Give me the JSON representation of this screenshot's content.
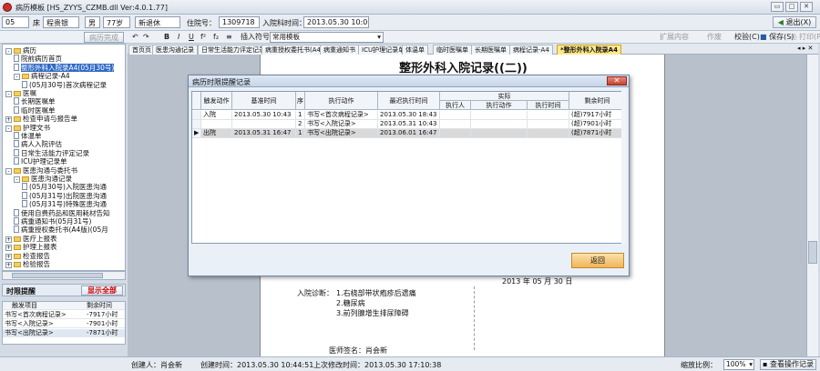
{
  "window": {
    "title": "病历模板 [HS_ZYYS_CZMB.dll Ver:4.0.1.77]",
    "min_label": "▭",
    "max_label": "□",
    "close_label": "✕"
  },
  "patient": {
    "bed": "05",
    "bed_label": "床",
    "name": "程贵银",
    "gender": "男",
    "age": "77岁",
    "insurance": "新退休",
    "inpatient_no_label": "住院号：",
    "inpatient_no": "1309718",
    "admit_time_label": "入院科时间：",
    "admit_time": "2013.05.30 10:00",
    "exit_label": "退出(X)"
  },
  "toolbar": {
    "complete": "病历完成",
    "bold": "B",
    "italic": "I",
    "underline": "U",
    "superscript": "f²",
    "subscript": "f₂",
    "insert_symbol_label": "插入符号",
    "insert_symbol_value": "常用模板",
    "expand": "扩展内容",
    "invalid": "作废",
    "validate": "校验(C)",
    "save": "保存(S)",
    "print": "打印(P)"
  },
  "tree": {
    "items": [
      {
        "text": "病历",
        "level": 0,
        "type": "folder",
        "exp": "-"
      },
      {
        "text": "院前病历首页",
        "level": 1,
        "type": "doc"
      },
      {
        "text": "整形外科入院录A4(05月30号)",
        "level": 1,
        "type": "doc",
        "selected": true
      },
      {
        "text": "病程记录-A4",
        "level": 1,
        "type": "folder",
        "exp": "-"
      },
      {
        "text": "(05月30号)首次病程记录",
        "level": 2,
        "type": "doc"
      },
      {
        "text": "医嘱",
        "level": 0,
        "type": "folder",
        "exp": "-"
      },
      {
        "text": "长期医嘱单",
        "level": 1,
        "type": "doc"
      },
      {
        "text": "临时医嘱单",
        "level": 1,
        "type": "doc"
      },
      {
        "text": "检查申请与报告单",
        "level": 0,
        "type": "folder",
        "exp": "+"
      },
      {
        "text": "护理文书",
        "level": 0,
        "type": "folder",
        "exp": "-"
      },
      {
        "text": "体温单",
        "level": 1,
        "type": "doc"
      },
      {
        "text": "病人入院评估",
        "level": 1,
        "type": "doc"
      },
      {
        "text": "日常生活能力评定记录",
        "level": 1,
        "type": "doc"
      },
      {
        "text": "ICU护理记录单",
        "level": 1,
        "type": "doc"
      },
      {
        "text": "医患沟通与委托书",
        "level": 0,
        "type": "folder",
        "exp": "-"
      },
      {
        "text": "医患沟通记录",
        "level": 1,
        "type": "folder",
        "exp": "-"
      },
      {
        "text": "(05月30号)入院医患沟通",
        "level": 2,
        "type": "doc"
      },
      {
        "text": "(05月31号)出院医患沟通",
        "level": 2,
        "type": "doc"
      },
      {
        "text": "(05月31号)特殊医患沟通",
        "level": 2,
        "type": "doc"
      },
      {
        "text": "使用自费药品和医用耗材告知",
        "level": 1,
        "type": "doc"
      },
      {
        "text": "病重通知书(05月31号)",
        "level": 1,
        "type": "doc"
      },
      {
        "text": "病重授权委托书(A4版)(05月",
        "level": 1,
        "type": "doc"
      },
      {
        "text": "医疗上报表",
        "level": 0,
        "type": "folder",
        "exp": "+"
      },
      {
        "text": "护理上报表",
        "level": 0,
        "type": "folder",
        "exp": "+"
      },
      {
        "text": "检查报告",
        "level": 0,
        "type": "folder",
        "exp": "+"
      },
      {
        "text": "检验报告",
        "level": 0,
        "type": "folder",
        "exp": "+"
      }
    ]
  },
  "reminder": {
    "title": "时限提醒",
    "show_all": "显示全部",
    "headers": [
      "触发项目",
      "剩余时间"
    ],
    "rows": [
      {
        "item": "书写<首次病程记录>",
        "time": "-7917小时"
      },
      {
        "item": "书写<入院记录>",
        "time": "-7901小时"
      },
      {
        "item": "书写<出院记录>",
        "time": "-7871小时"
      }
    ]
  },
  "tabs": [
    "首页页",
    "医患沟通记录",
    "日常生活能力评定记录",
    "病重授权委托书(A4版)",
    "病重通知书",
    "ICU护理记录单",
    "体温单",
    "临时医嘱单",
    "长期医嘱单",
    "病程记录-A4",
    "*整形外科入院录A4"
  ],
  "document": {
    "title": "整形外科入院记录((二))",
    "signed_date": "2013 年 05 月 30 日",
    "diag_label": "入院诊断：",
    "diagnoses": [
      "1.右桡部带状疱疹后遗痛",
      "2.糖尿病",
      "3.前列腺增生排尿障碍"
    ],
    "doctor_label": "医师签名：",
    "doctor": "肖会新"
  },
  "modal": {
    "title": "病历时限提醒记录",
    "headers": {
      "trigger": "触发动作",
      "base_time": "基准时间",
      "seq": "序",
      "action": "执行动作",
      "deadline": "最迟执行时间",
      "actual": "实际",
      "executor": "执行人",
      "exec_action": "执行动作",
      "exec_time": "执行时间",
      "remaining": "剩余时间"
    },
    "rows": [
      {
        "trigger": "入院",
        "base_time": "2013.05.30 10:43",
        "seq": "1",
        "action": "书写<首次病程记录>",
        "deadline": "2013.05.30 18:43",
        "executor": "",
        "exec_action": "",
        "exec_time": "",
        "remaining": "(超)7917小时",
        "selected": false
      },
      {
        "trigger": "",
        "base_time": "",
        "seq": "2",
        "action": "书写<入院记录>",
        "deadline": "2013.05.31 10:43",
        "executor": "",
        "exec_action": "",
        "exec_time": "",
        "remaining": "(超)7901小时",
        "selected": false
      },
      {
        "trigger": "出院",
        "base_time": "2013.05.31 16:47",
        "seq": "1",
        "action": "书写<出院记录>",
        "deadline": "2013.06.01 16:47",
        "executor": "",
        "exec_action": "",
        "exec_time": "",
        "remaining": "(超)7871小时",
        "selected": true
      }
    ],
    "return_label": "返回"
  },
  "status": {
    "creator_label": "创建人：",
    "creator": "肖会新",
    "create_time_label": "创建时间：",
    "create_time": "2013.05.30 10:44:51",
    "modify_time_label": "上次修改时间：",
    "modify_time": "2013.05.30 17:10:38",
    "zoom_label": "缩放比例：",
    "zoom": "100%",
    "view_log": "查看操作记录"
  },
  "colors": {
    "selected_tab": "#ffe98a",
    "tree_selection": "#316ac5",
    "overdue_text": "#111111",
    "return_button": "#f3c680"
  }
}
